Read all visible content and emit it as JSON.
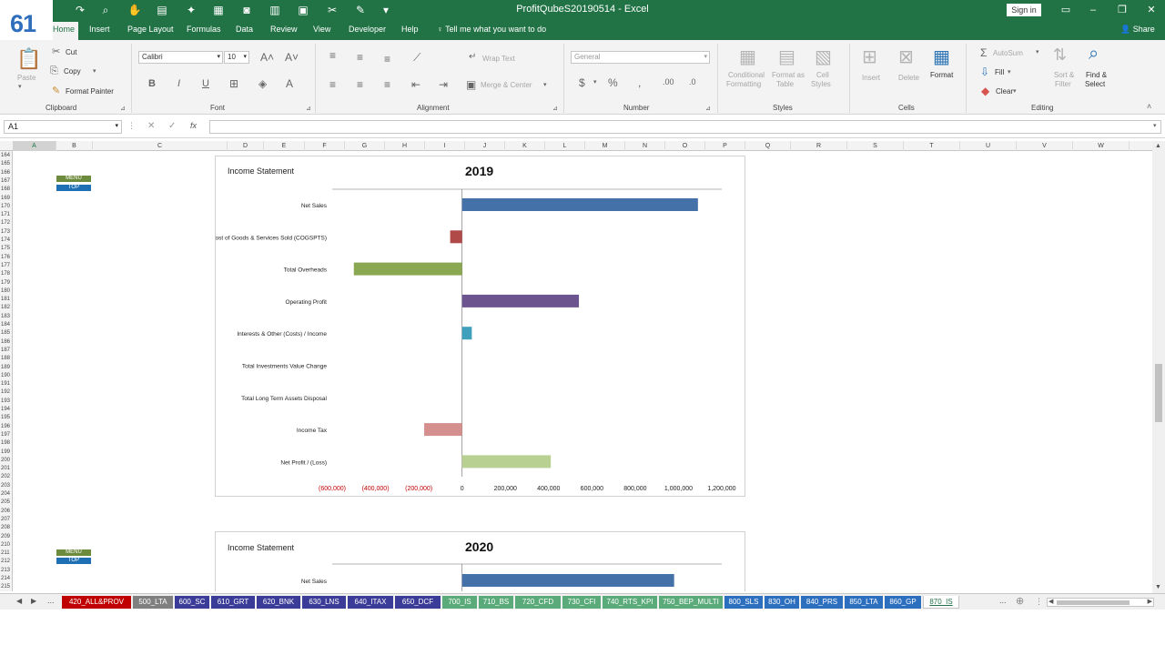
{
  "badge": "61",
  "window": {
    "title": "ProfitQubeS20190514  -  Excel",
    "sign_in": "Sign in",
    "minimize": "–",
    "restore": "❐",
    "close": "✕"
  },
  "ribbon_tabs": [
    "Home",
    "Insert",
    "Page Layout",
    "Formulas",
    "Data",
    "Review",
    "View",
    "Developer",
    "Help"
  ],
  "tell_me": "Tell me what you want to do",
  "share": "Share",
  "ribbon": {
    "clipboard": {
      "label": "Clipboard",
      "paste": "Paste",
      "cut": "Cut",
      "copy": "Copy",
      "format_painter": "Format Painter"
    },
    "font": {
      "label": "Font",
      "font_name": "Calibri",
      "font_size": "10"
    },
    "alignment": {
      "label": "Alignment",
      "wrap_text": "Wrap Text",
      "merge_center": "Merge & Center"
    },
    "number": {
      "label": "Number",
      "format": "General"
    },
    "styles": {
      "label": "Styles",
      "conditional": "Conditional",
      "formatting": "Formatting",
      "format_as": "Format as",
      "table": "Table",
      "cell": "Cell",
      "styles_word": "Styles"
    },
    "cells": {
      "label": "Cells",
      "insert": "Insert",
      "delete": "Delete",
      "format": "Format"
    },
    "editing": {
      "label": "Editing",
      "autosum": "AutoSum",
      "fill": "Fill",
      "clear": "Clear",
      "sort": "Sort &",
      "filter": "Filter",
      "find": "Find &",
      "select": "Select"
    }
  },
  "name_box": "A1",
  "columns": [
    "A",
    "B",
    "C",
    "D",
    "E",
    "F",
    "G",
    "H",
    "I",
    "J",
    "K",
    "L",
    "M",
    "N",
    "O",
    "P",
    "Q",
    "R",
    "S",
    "T",
    "U",
    "V",
    "W"
  ],
  "rows_start": 164,
  "rows_end": 215,
  "nav_buttons": {
    "menu": "MENU",
    "top": "TOP"
  },
  "charts": [
    {
      "title": "Income Statement",
      "year": "2019",
      "categories": [
        "Net Sales",
        "Cost of Goods & Services Sold (COGSPTS)",
        "Total Overheads",
        "Operating Profit",
        "Interests & Other (Costs) / Income",
        "Total Investments Value Change",
        "Total Long Term Assets Disposal",
        "Income Tax",
        "Net Profit / (Loss)"
      ],
      "values": [
        1090000,
        -55000,
        -500000,
        540000,
        45000,
        0,
        0,
        -175000,
        410000
      ],
      "colors": [
        "#4472a8",
        "#b04a48",
        "#8aa852",
        "#6c548e",
        "#3ea0bc",
        "#888888",
        "#888888",
        "#d48f8e",
        "#b8d193"
      ],
      "xlim": [
        -600000,
        1200000
      ],
      "ticks": [
        "(600,000)",
        "(400,000)",
        "(200,000)",
        "0",
        "200,000",
        "400,000",
        "600,000",
        "800,000",
        "1,000,000",
        "1,200,000"
      ]
    },
    {
      "title": "Income Statement",
      "year": "2020",
      "categories": [
        "Net Sales"
      ],
      "values": [
        980000
      ],
      "colors": [
        "#4472a8"
      ],
      "xlim": [
        -600000,
        1200000
      ]
    }
  ],
  "sheet_tabs": [
    {
      "name": "420_ALL&PROV",
      "color": "#c00000"
    },
    {
      "name": "500_LTA",
      "color": "#7f7f7f"
    },
    {
      "name": "600_SC",
      "color": "#3b3b98"
    },
    {
      "name": "610_GRT",
      "color": "#3b3b98"
    },
    {
      "name": "620_BNK",
      "color": "#3b3b98"
    },
    {
      "name": "630_LNS",
      "color": "#3b3b98"
    },
    {
      "name": "640_ITAX",
      "color": "#3b3b98"
    },
    {
      "name": "650_DCF",
      "color": "#3b3b98"
    },
    {
      "name": "700_IS",
      "color": "#5aab79"
    },
    {
      "name": "710_BS",
      "color": "#5aab79"
    },
    {
      "name": "720_CFD",
      "color": "#5aab79"
    },
    {
      "name": "730_CFI",
      "color": "#5aab79"
    },
    {
      "name": "740_RTS_KPI",
      "color": "#5aab79"
    },
    {
      "name": "750_BEP_MULTI",
      "color": "#5aab79"
    },
    {
      "name": "800_SLS",
      "color": "#2c6fbf"
    },
    {
      "name": "830_OH",
      "color": "#2c6fbf"
    },
    {
      "name": "840_PRS",
      "color": "#2c6fbf"
    },
    {
      "name": "850_LTA",
      "color": "#2c6fbf"
    },
    {
      "name": "860_GP",
      "color": "#2c6fbf"
    },
    {
      "name": "870_IS",
      "color": "#ffffff",
      "active": true
    }
  ],
  "ellipsis": "..."
}
